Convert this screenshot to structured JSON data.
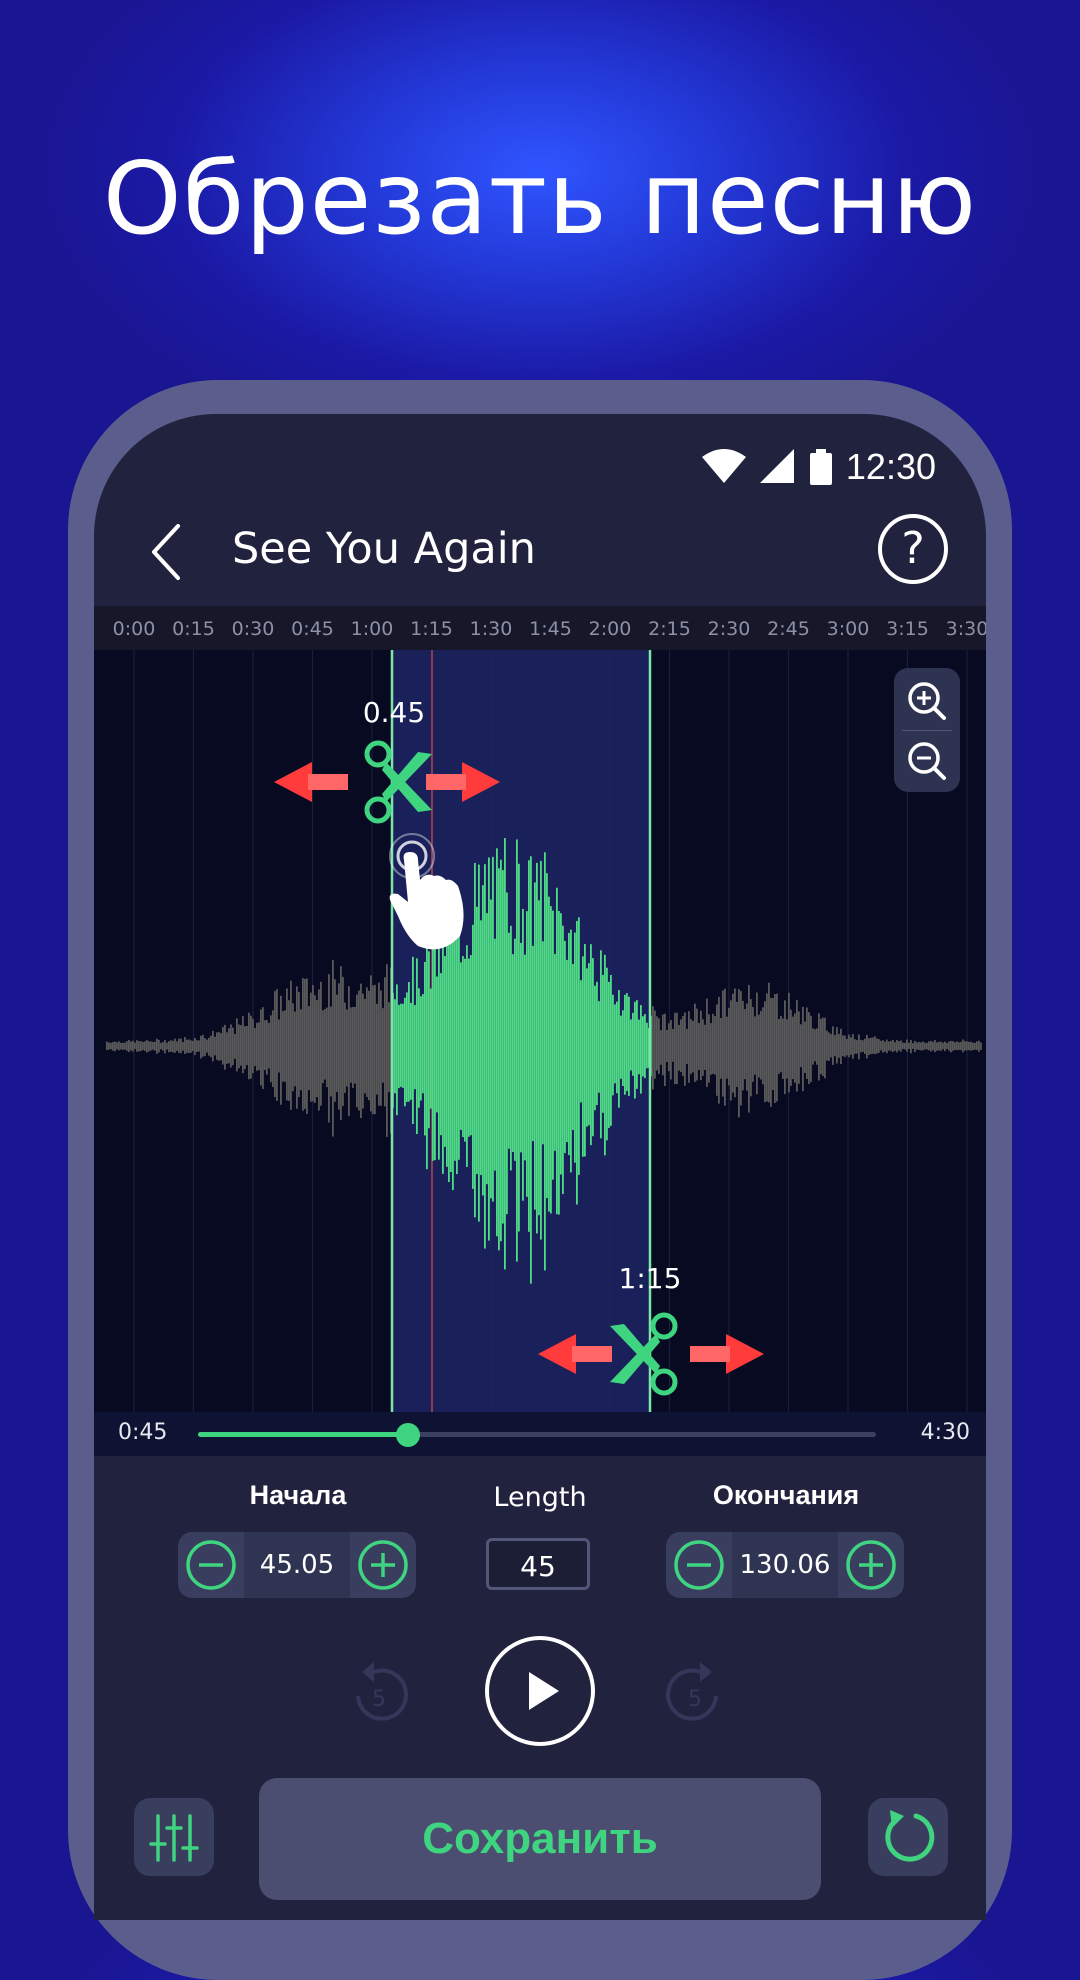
{
  "headline": "Обрезать песню",
  "status_bar": {
    "time": "12:30",
    "icons": [
      "wifi-icon",
      "signal-icon",
      "battery-icon"
    ]
  },
  "header": {
    "back_icon": "chevron-left-icon",
    "title": "See You Again",
    "help_icon": "help-circle-icon"
  },
  "timeline": {
    "ticks": [
      "0:00",
      "0:15",
      "0:30",
      "0:45",
      "1:00",
      "1:15",
      "1:30",
      "1:45",
      "2:00",
      "2:15",
      "2:30",
      "2:45",
      "3:00",
      "3:15",
      "3:30"
    ]
  },
  "waveform": {
    "start_marker_label": "0.45",
    "end_marker_label": "1:15",
    "zoom_in_icon": "zoom-in-icon",
    "zoom_out_icon": "zoom-out-icon",
    "handle_icon": "scissors-icon",
    "gesture_icon": "tap-hand-icon"
  },
  "playback": {
    "current_time": "0:45",
    "total_time": "4:30",
    "progress": 0.31
  },
  "controls": {
    "start_label": "Начала",
    "start_value": "45.05",
    "length_label": "Length",
    "length_value": "45",
    "end_label": "Окончания",
    "end_value": "130.06",
    "skip_back_label": "5",
    "skip_forward_label": "5"
  },
  "bottom": {
    "save_label": "Сохранить",
    "equalizer_icon": "equalizer-icon",
    "reset_icon": "refresh-icon"
  },
  "colors": {
    "accent_green": "#3fd480",
    "arrow_red": "#ff3b3b",
    "background": "#1b1aa6",
    "screen": "#21223d"
  }
}
